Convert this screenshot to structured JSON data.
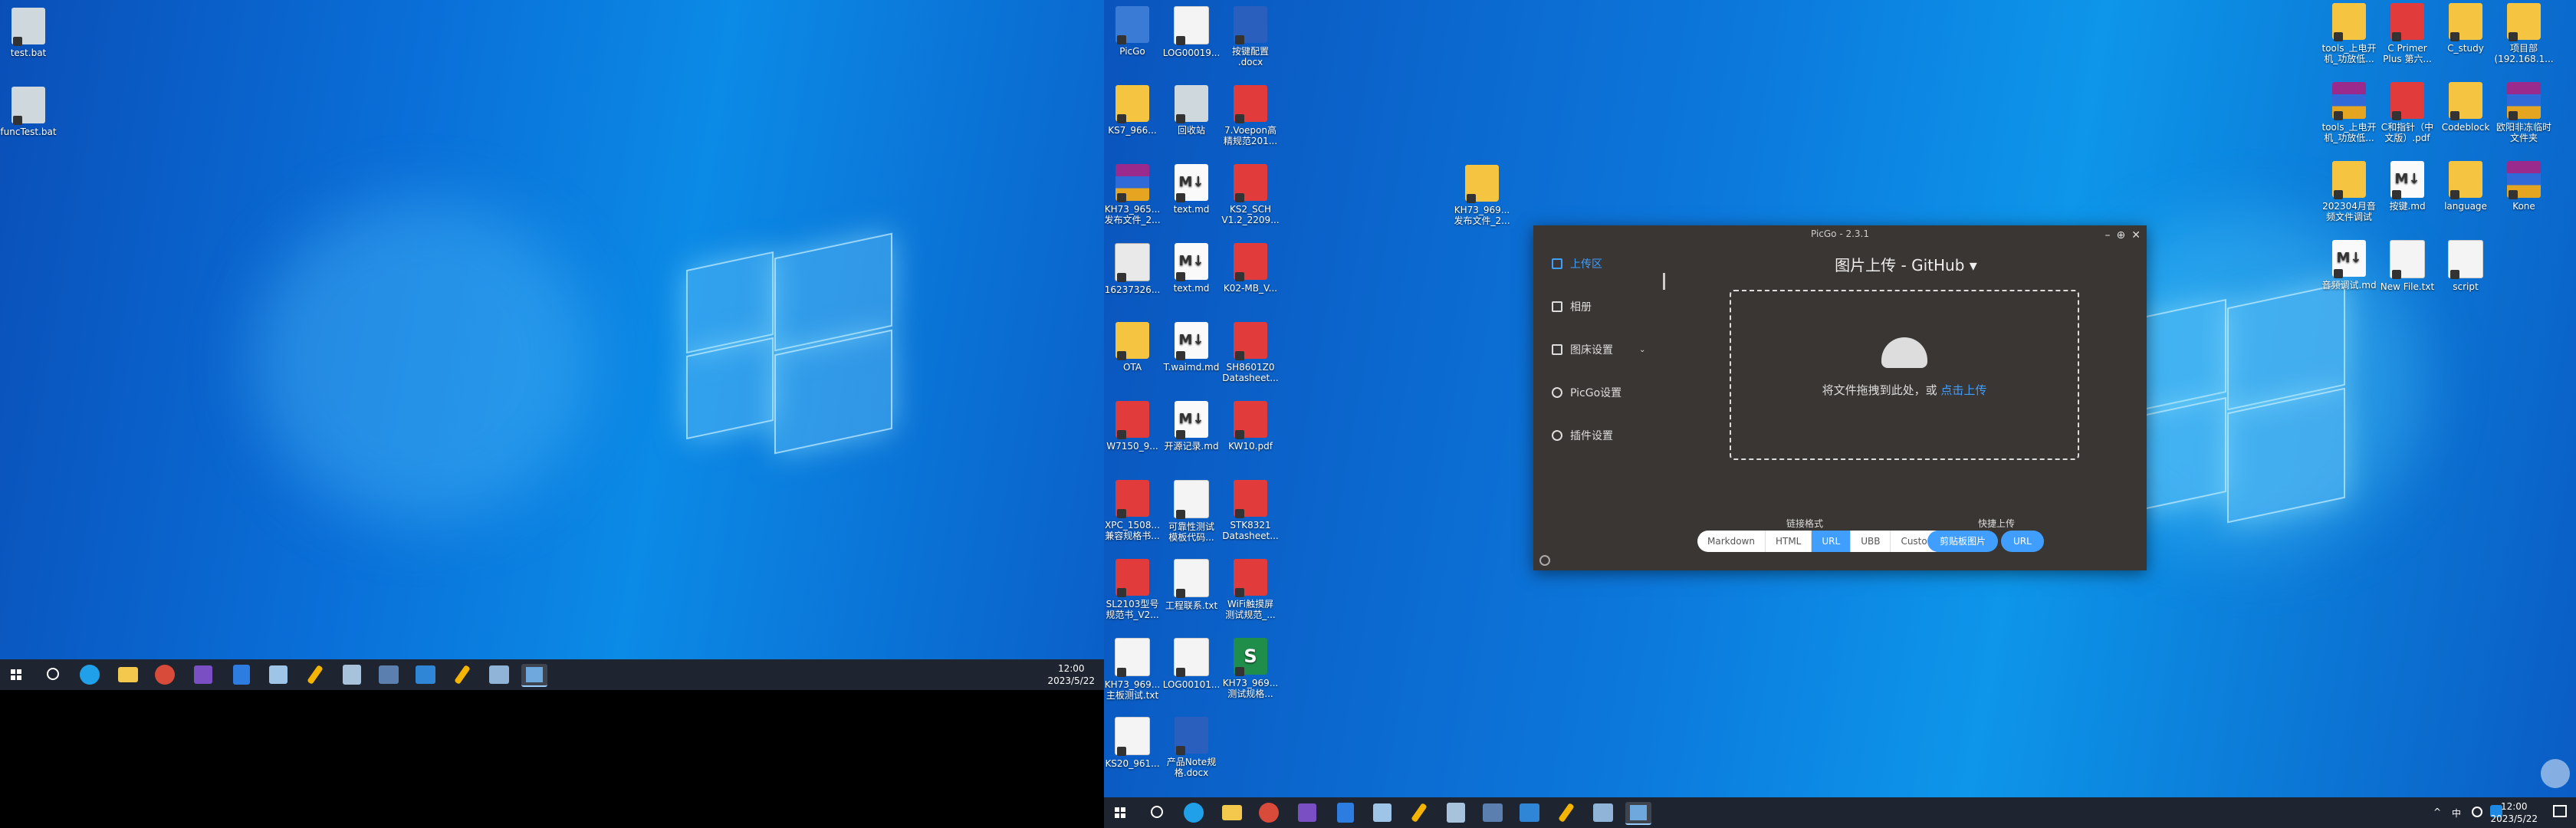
{
  "monitor1": {
    "desktop_icons": [
      {
        "label": "test.bat",
        "type": "gear"
      },
      {
        "label": "funcTest.bat",
        "type": "gear"
      }
    ],
    "taskbar": {
      "time": "12:00",
      "date": "2023/5/22"
    }
  },
  "monitor2": {
    "desktop_icons_left": [
      {
        "label": "PicGo",
        "type": "util"
      },
      {
        "label": "LOG00019...",
        "type": "doc"
      },
      {
        "label": "按键配置\n.docx",
        "type": "word"
      },
      {
        "label": "KS7_966...",
        "type": "folder"
      },
      {
        "label": "回收站",
        "type": "gear"
      },
      {
        "label": "7.Voepon高\n精规范201...",
        "type": "pdf"
      },
      {
        "label": "KH73_965...\n发布文件_2...",
        "type": "rar"
      },
      {
        "label": "text.md",
        "type": "md"
      },
      {
        "label": "KS2_SCH\nV1.2_2209...",
        "type": "pdf"
      },
      {
        "label": "16237326...",
        "type": "png"
      },
      {
        "label": "text.md",
        "type": "md"
      },
      {
        "label": "K02-MB_V...",
        "type": "pdf"
      },
      {
        "label": "OTA",
        "type": "folder"
      },
      {
        "label": "T.waimd.md",
        "type": "md"
      },
      {
        "label": "SH8601Z0\nDatasheet...",
        "type": "pdf"
      },
      {
        "label": "W7150_9...",
        "type": "pdf"
      },
      {
        "label": "开源记录.md",
        "type": "md"
      },
      {
        "label": "KW10.pdf",
        "type": "pdf"
      },
      {
        "label": "XPC_1508...\n兼容规格书...",
        "type": "pdf"
      },
      {
        "label": "可靠性测试\n模板代码...",
        "type": "doc"
      },
      {
        "label": "STK8321\nDatasheet...",
        "type": "pdf"
      },
      {
        "label": "SL2103型号\n规范书_V2...",
        "type": "pdf"
      },
      {
        "label": "工程联系.txt",
        "type": "doc"
      },
      {
        "label": "WiFi触摸屏\n测试规范_...",
        "type": "pdf"
      },
      {
        "label": "KH73_969...\n主板测试.txt",
        "type": "doc"
      },
      {
        "label": "LOG00101...",
        "type": "doc"
      },
      {
        "label": "KH73_969...\n测试规格...",
        "type": "xls"
      },
      {
        "label": "KS20_961...",
        "type": "doc"
      },
      {
        "label": "产品Note规\n格.docx",
        "type": "word"
      }
    ],
    "desktop_icon_mid": {
      "label": "KH73_969...\n发布文件_2...",
      "type": "folder"
    },
    "desktop_icons_right": [
      {
        "label": "tools_上电开\n机_功放低...",
        "type": "folder"
      },
      {
        "label": "C Primer\nPlus 第六...",
        "type": "pdf"
      },
      {
        "label": "C_study",
        "type": "folder"
      },
      {
        "label": "项目部\n(192.168.1...",
        "type": "folder"
      },
      {
        "label": "tools_上电开\n机_功放低...",
        "type": "rar"
      },
      {
        "label": "C和指针（中\n文版）.pdf",
        "type": "pdf"
      },
      {
        "label": "Codeblock",
        "type": "folder"
      },
      {
        "label": "欧阳非冻临时\n文件夹",
        "type": "rar"
      },
      {
        "label": "202304月音\n频文件调试",
        "type": "folder"
      },
      {
        "label": "按键.md",
        "type": "md"
      },
      {
        "label": "language",
        "type": "folder"
      },
      {
        "label": "Kone",
        "type": "rar"
      },
      {
        "label": "音频调试.md",
        "type": "md"
      },
      {
        "label": "New File.txt",
        "type": "doc"
      },
      {
        "label": "script",
        "type": "doc"
      }
    ],
    "taskbar": {
      "time": "12:00",
      "date": "2023/5/22",
      "lang": "中"
    }
  },
  "picgo": {
    "title": "PicGo - 2.3.1",
    "nav": [
      {
        "label": "上传区",
        "icon": "upload-icon",
        "active": true
      },
      {
        "label": "相册",
        "icon": "album-icon",
        "active": false
      },
      {
        "label": "图床设置",
        "icon": "grid-icon",
        "active": false
      },
      {
        "label": "PicGo设置",
        "icon": "settings-icon",
        "active": false
      },
      {
        "label": "插件设置",
        "icon": "share-icon",
        "active": false
      }
    ],
    "header": "图片上传 - GitHub ▾",
    "drop_text": "将文件拖拽到此处，或 ",
    "drop_link": "点击上传",
    "link_format_label": "链接格式",
    "link_formats": [
      "Markdown",
      "HTML",
      "URL",
      "UBB",
      "Custom"
    ],
    "link_format_selected": "URL",
    "quick_upload_label": "快捷上传",
    "quick_buttons": [
      "剪贴板图片",
      "URL"
    ]
  }
}
